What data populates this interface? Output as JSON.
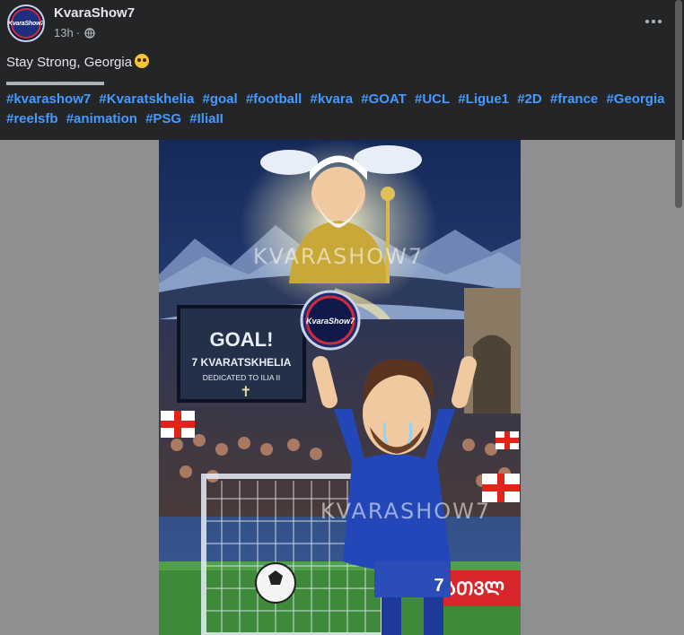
{
  "post": {
    "page_name": "KvaraShow7",
    "timestamp": "13h",
    "separator": "·",
    "avatar_text": "KvaraShow7",
    "caption": "Stay Strong, Georgia",
    "emoji": "pleading-face",
    "divider": "▬▬▬▬▬▬▬▬▬",
    "hashtags": [
      "#kvarashow7",
      "#Kvaratskhelia",
      "#goal",
      "#football",
      "#kvara",
      "#GOAT",
      "#UCL",
      "#Ligue1",
      "#2D",
      "#france",
      "#Georgia",
      "#reelsfb",
      "#animation",
      "#PSG",
      "#IliaII"
    ]
  },
  "image": {
    "scoreboard_title": "GOAL!",
    "scoreboard_line1": "7 KVARATSKHELIA",
    "scoreboard_line2": "DEDICATED TO ILIA II",
    "cross": "✝",
    "watermark": "KVARASHOW7",
    "badge_text": "KvaraShow7",
    "jersey_number": "7",
    "board_text": "ᲐᲗᲕᲚ"
  },
  "colors": {
    "header_bg": "#242526",
    "hashtag": "#4599ff",
    "text_primary": "#e4e6eb",
    "text_secondary": "#b0b3b8",
    "backdrop": "#8f8f91"
  }
}
